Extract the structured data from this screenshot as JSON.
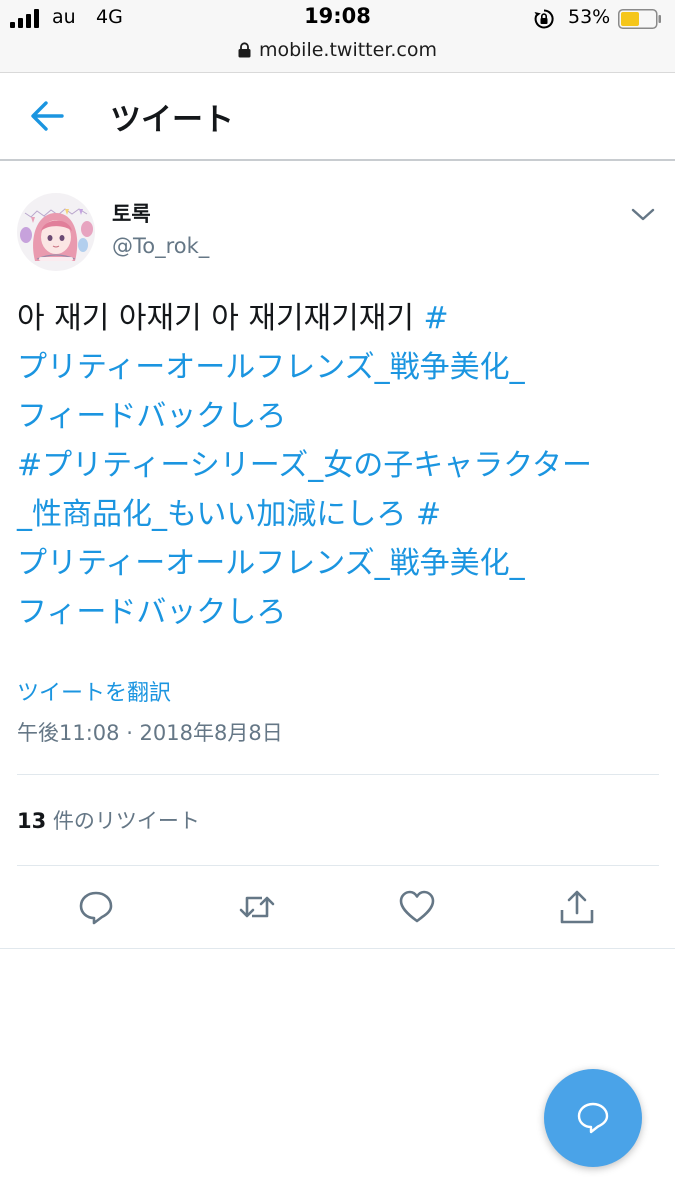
{
  "status_bar": {
    "carrier": "au",
    "network": "4G",
    "time": "19:08",
    "battery_percent_label": "53%",
    "battery_level": 0.53,
    "url": "mobile.twitter.com"
  },
  "header": {
    "title": "ツイート",
    "back_icon": "arrow-left-icon"
  },
  "tweet": {
    "author": {
      "name": "토록",
      "handle": "@To_rok_"
    },
    "text_lines": [
      [
        {
          "t": "아 재기 아재기 아 재기재기재기 ",
          "h": false
        },
        {
          "t": "#",
          "h": true
        }
      ],
      [
        {
          "t": "プリティーオールフレンズ_戦争美化_",
          "h": true
        }
      ],
      [
        {
          "t": "フィードバックしろ",
          "h": true
        }
      ],
      [
        {
          "t": "#プリティーシリーズ_女の子キャラクター",
          "h": true
        }
      ],
      [
        {
          "t": "_性商品化_もいい加減にしろ",
          "h": true
        },
        {
          "t": " ",
          "h": false
        },
        {
          "t": "#",
          "h": true
        }
      ],
      [
        {
          "t": "プリティーオールフレンズ_戦争美化_",
          "h": true
        }
      ],
      [
        {
          "t": "フィードバックしろ",
          "h": true
        }
      ]
    ],
    "translate_label": "ツイートを翻訳",
    "timestamp": "午後11:08 · 2018年8月8日",
    "retweet_count": "13",
    "retweet_label": " 件のリツイート"
  },
  "actions": [
    "reply-icon",
    "retweet-icon",
    "like-icon",
    "share-icon"
  ],
  "fab_icon": "compose-reply-icon",
  "colors": {
    "accent": "#1b95e0",
    "text": "#14171a",
    "muted": "#657786",
    "fab": "#4aa3e8",
    "battery_fill": "#f5c61b"
  }
}
